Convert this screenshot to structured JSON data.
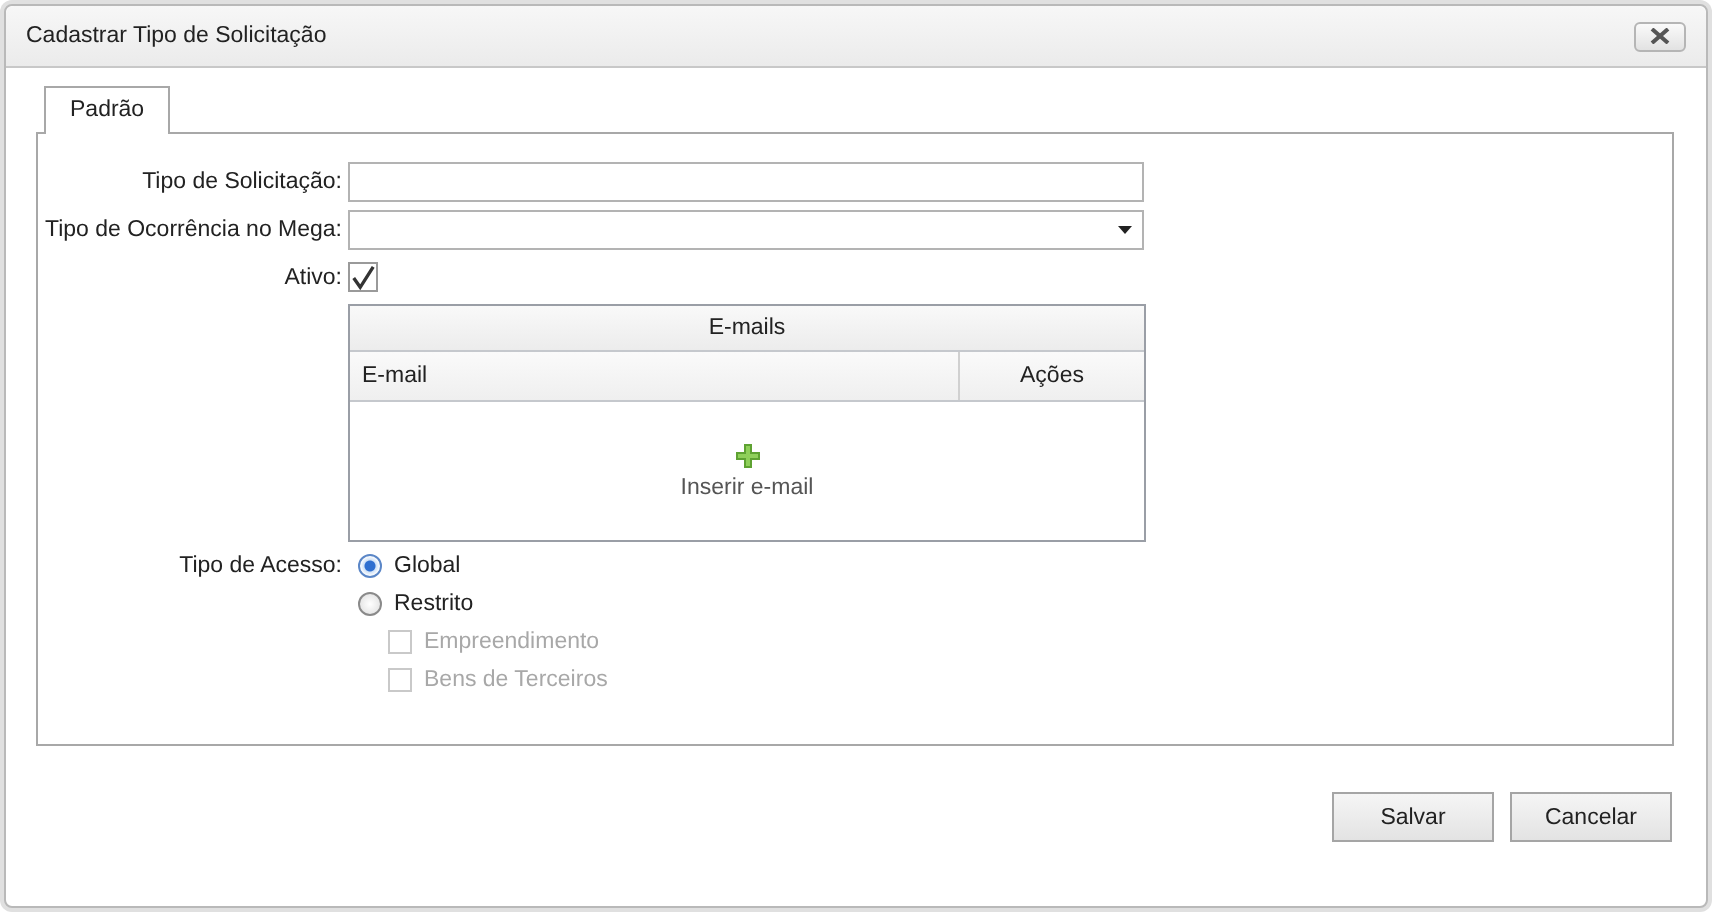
{
  "window": {
    "title": "Cadastrar Tipo de Solicitação"
  },
  "tabs": [
    {
      "label": "Padrão",
      "selected": true
    }
  ],
  "fields": [
    {
      "label": "Tipo de Solicitação:",
      "kind": "text"
    },
    {
      "label": "Tipo de Ocorrência no Mega:",
      "kind": "select"
    }
  ],
  "active": {
    "label": "Ativo:",
    "checked": true
  },
  "emails": {
    "title": "E-mails",
    "columns": [
      "E-mail",
      "Ações"
    ],
    "add_label": "Inserir e-mail"
  },
  "access": {
    "label": "Tipo de Acesso:",
    "options": [
      {
        "label": "Global",
        "selected": true
      },
      {
        "label": "Restrito",
        "selected": false,
        "suboptions": [
          {
            "label": "Empreendimento",
            "checked": false,
            "disabled": true
          },
          {
            "label": "Bens de Terceiros",
            "checked": false,
            "disabled": true
          }
        ]
      }
    ]
  },
  "buttons": [
    "Salvar",
    "Cancelar"
  ]
}
